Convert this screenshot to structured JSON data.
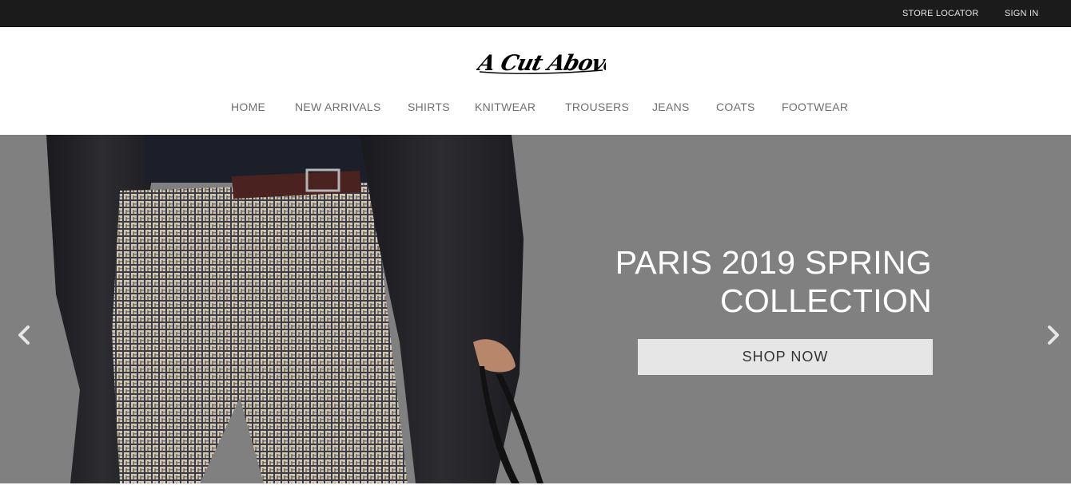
{
  "topbar": {
    "store_locator": "STORE LOCATOR",
    "sign_in": "SIGN IN"
  },
  "header": {
    "logo_text": "A Cut Above"
  },
  "nav": {
    "items": [
      {
        "label": "HOME"
      },
      {
        "label": "NEW ARRIVALS"
      },
      {
        "label": "SHIRTS"
      },
      {
        "label": "KNITWEAR"
      },
      {
        "label": "TROUSERS"
      },
      {
        "label": "JEANS"
      },
      {
        "label": "COATS"
      },
      {
        "label": "FOOTWEAR"
      }
    ]
  },
  "hero": {
    "title_line1": "PARIS 2019 SPRING",
    "title_line2": "COLLECTION",
    "button_label": "SHOP NOW",
    "prev_icon": "chevron-left-icon",
    "next_icon": "chevron-right-icon"
  },
  "colors": {
    "topbar_bg": "#1b1b1b",
    "hero_bg": "#808080",
    "button_bg": "#e6e6e6",
    "nav_text": "#6f6f6f"
  }
}
